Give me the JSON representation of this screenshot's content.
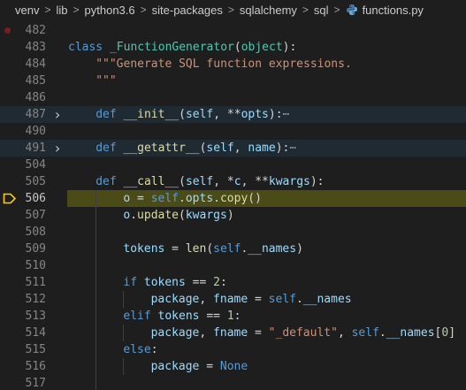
{
  "breadcrumb": {
    "items": [
      "venv",
      "lib",
      "python3.6",
      "site-packages",
      "sqlalchemy",
      "sql"
    ],
    "file": "functions.py"
  },
  "lines": [
    {
      "num": "482",
      "breakpoint": true,
      "tokens": []
    },
    {
      "num": "483",
      "tokens": [
        {
          "t": "class ",
          "c": "k"
        },
        {
          "t": "_FunctionGenerator",
          "c": "c"
        },
        {
          "t": "(",
          "c": "o"
        },
        {
          "t": "object",
          "c": "c"
        },
        {
          "t": "):",
          "c": "o"
        }
      ]
    },
    {
      "num": "484",
      "indent": 1,
      "tokens": [
        {
          "t": "\"\"\"Generate SQL function expressions.",
          "c": "s"
        }
      ]
    },
    {
      "num": "485",
      "indent": 1,
      "tokens": [
        {
          "t": "\"\"\"",
          "c": "s"
        }
      ]
    },
    {
      "num": "486",
      "tokens": []
    },
    {
      "num": "487",
      "fold": true,
      "highlight": "fold",
      "indent": 1,
      "tokens": [
        {
          "t": "def ",
          "c": "k"
        },
        {
          "t": "__init__",
          "c": "f"
        },
        {
          "t": "(",
          "c": "o"
        },
        {
          "t": "self",
          "c": "p"
        },
        {
          "t": ", **",
          "c": "o"
        },
        {
          "t": "opts",
          "c": "p"
        },
        {
          "t": "):",
          "c": "o"
        },
        {
          "t": "⋯",
          "c": "ell"
        }
      ]
    },
    {
      "num": "490",
      "tokens": []
    },
    {
      "num": "491",
      "fold": true,
      "highlight": "fold",
      "indent": 1,
      "tokens": [
        {
          "t": "def ",
          "c": "k"
        },
        {
          "t": "__getattr__",
          "c": "f"
        },
        {
          "t": "(",
          "c": "o"
        },
        {
          "t": "self",
          "c": "p"
        },
        {
          "t": ", ",
          "c": "o"
        },
        {
          "t": "name",
          "c": "p"
        },
        {
          "t": "):",
          "c": "o"
        },
        {
          "t": "⋯",
          "c": "ell"
        }
      ]
    },
    {
      "num": "504",
      "tokens": []
    },
    {
      "num": "505",
      "indent": 1,
      "tokens": [
        {
          "t": "def ",
          "c": "k"
        },
        {
          "t": "__call__",
          "c": "f"
        },
        {
          "t": "(",
          "c": "o"
        },
        {
          "t": "self",
          "c": "p"
        },
        {
          "t": ", *",
          "c": "o"
        },
        {
          "t": "c",
          "c": "p"
        },
        {
          "t": ", **",
          "c": "o"
        },
        {
          "t": "kwargs",
          "c": "p"
        },
        {
          "t": "):",
          "c": "o"
        }
      ]
    },
    {
      "num": "506",
      "current": true,
      "highlight": "current",
      "indent": 2,
      "tokens": [
        {
          "t": "o",
          "c": "p"
        },
        {
          "t": " = ",
          "c": "o"
        },
        {
          "t": "self",
          "c": "k"
        },
        {
          "t": ".",
          "c": "o"
        },
        {
          "t": "opts",
          "c": "p"
        },
        {
          "t": ".",
          "c": "o"
        },
        {
          "t": "copy",
          "c": "f"
        },
        {
          "t": "()",
          "c": "o"
        }
      ]
    },
    {
      "num": "507",
      "indent": 2,
      "tokens": [
        {
          "t": "o",
          "c": "p"
        },
        {
          "t": ".",
          "c": "o"
        },
        {
          "t": "update",
          "c": "f"
        },
        {
          "t": "(",
          "c": "o"
        },
        {
          "t": "kwargs",
          "c": "p"
        },
        {
          "t": ")",
          "c": "o"
        }
      ]
    },
    {
      "num": "508",
      "tokens": []
    },
    {
      "num": "509",
      "indent": 2,
      "tokens": [
        {
          "t": "tokens",
          "c": "p"
        },
        {
          "t": " = ",
          "c": "o"
        },
        {
          "t": "len",
          "c": "f"
        },
        {
          "t": "(",
          "c": "o"
        },
        {
          "t": "self",
          "c": "k"
        },
        {
          "t": ".",
          "c": "o"
        },
        {
          "t": "__names",
          "c": "p"
        },
        {
          "t": ")",
          "c": "o"
        }
      ]
    },
    {
      "num": "510",
      "tokens": []
    },
    {
      "num": "511",
      "indent": 2,
      "tokens": [
        {
          "t": "if ",
          "c": "k"
        },
        {
          "t": "tokens",
          "c": "p"
        },
        {
          "t": " == ",
          "c": "o"
        },
        {
          "t": "2",
          "c": "n"
        },
        {
          "t": ":",
          "c": "o"
        }
      ]
    },
    {
      "num": "512",
      "indent": 3,
      "tokens": [
        {
          "t": "package",
          "c": "p"
        },
        {
          "t": ", ",
          "c": "o"
        },
        {
          "t": "fname",
          "c": "p"
        },
        {
          "t": " = ",
          "c": "o"
        },
        {
          "t": "self",
          "c": "k"
        },
        {
          "t": ".",
          "c": "o"
        },
        {
          "t": "__names",
          "c": "p"
        }
      ]
    },
    {
      "num": "513",
      "indent": 2,
      "tokens": [
        {
          "t": "elif ",
          "c": "k"
        },
        {
          "t": "tokens",
          "c": "p"
        },
        {
          "t": " == ",
          "c": "o"
        },
        {
          "t": "1",
          "c": "n"
        },
        {
          "t": ":",
          "c": "o"
        }
      ]
    },
    {
      "num": "514",
      "indent": 3,
      "tokens": [
        {
          "t": "package",
          "c": "p"
        },
        {
          "t": ", ",
          "c": "o"
        },
        {
          "t": "fname",
          "c": "p"
        },
        {
          "t": " = ",
          "c": "o"
        },
        {
          "t": "\"_default\"",
          "c": "s"
        },
        {
          "t": ", ",
          "c": "o"
        },
        {
          "t": "self",
          "c": "k"
        },
        {
          "t": ".",
          "c": "o"
        },
        {
          "t": "__names",
          "c": "p"
        },
        {
          "t": "[",
          "c": "o"
        },
        {
          "t": "0",
          "c": "n"
        },
        {
          "t": "]",
          "c": "o"
        }
      ]
    },
    {
      "num": "515",
      "indent": 2,
      "tokens": [
        {
          "t": "else",
          "c": "k"
        },
        {
          "t": ":",
          "c": "o"
        }
      ]
    },
    {
      "num": "516",
      "indent": 3,
      "tokens": [
        {
          "t": "package",
          "c": "p"
        },
        {
          "t": " = ",
          "c": "o"
        },
        {
          "t": "None",
          "c": "k"
        }
      ]
    },
    {
      "num": "517",
      "tokens": []
    }
  ]
}
